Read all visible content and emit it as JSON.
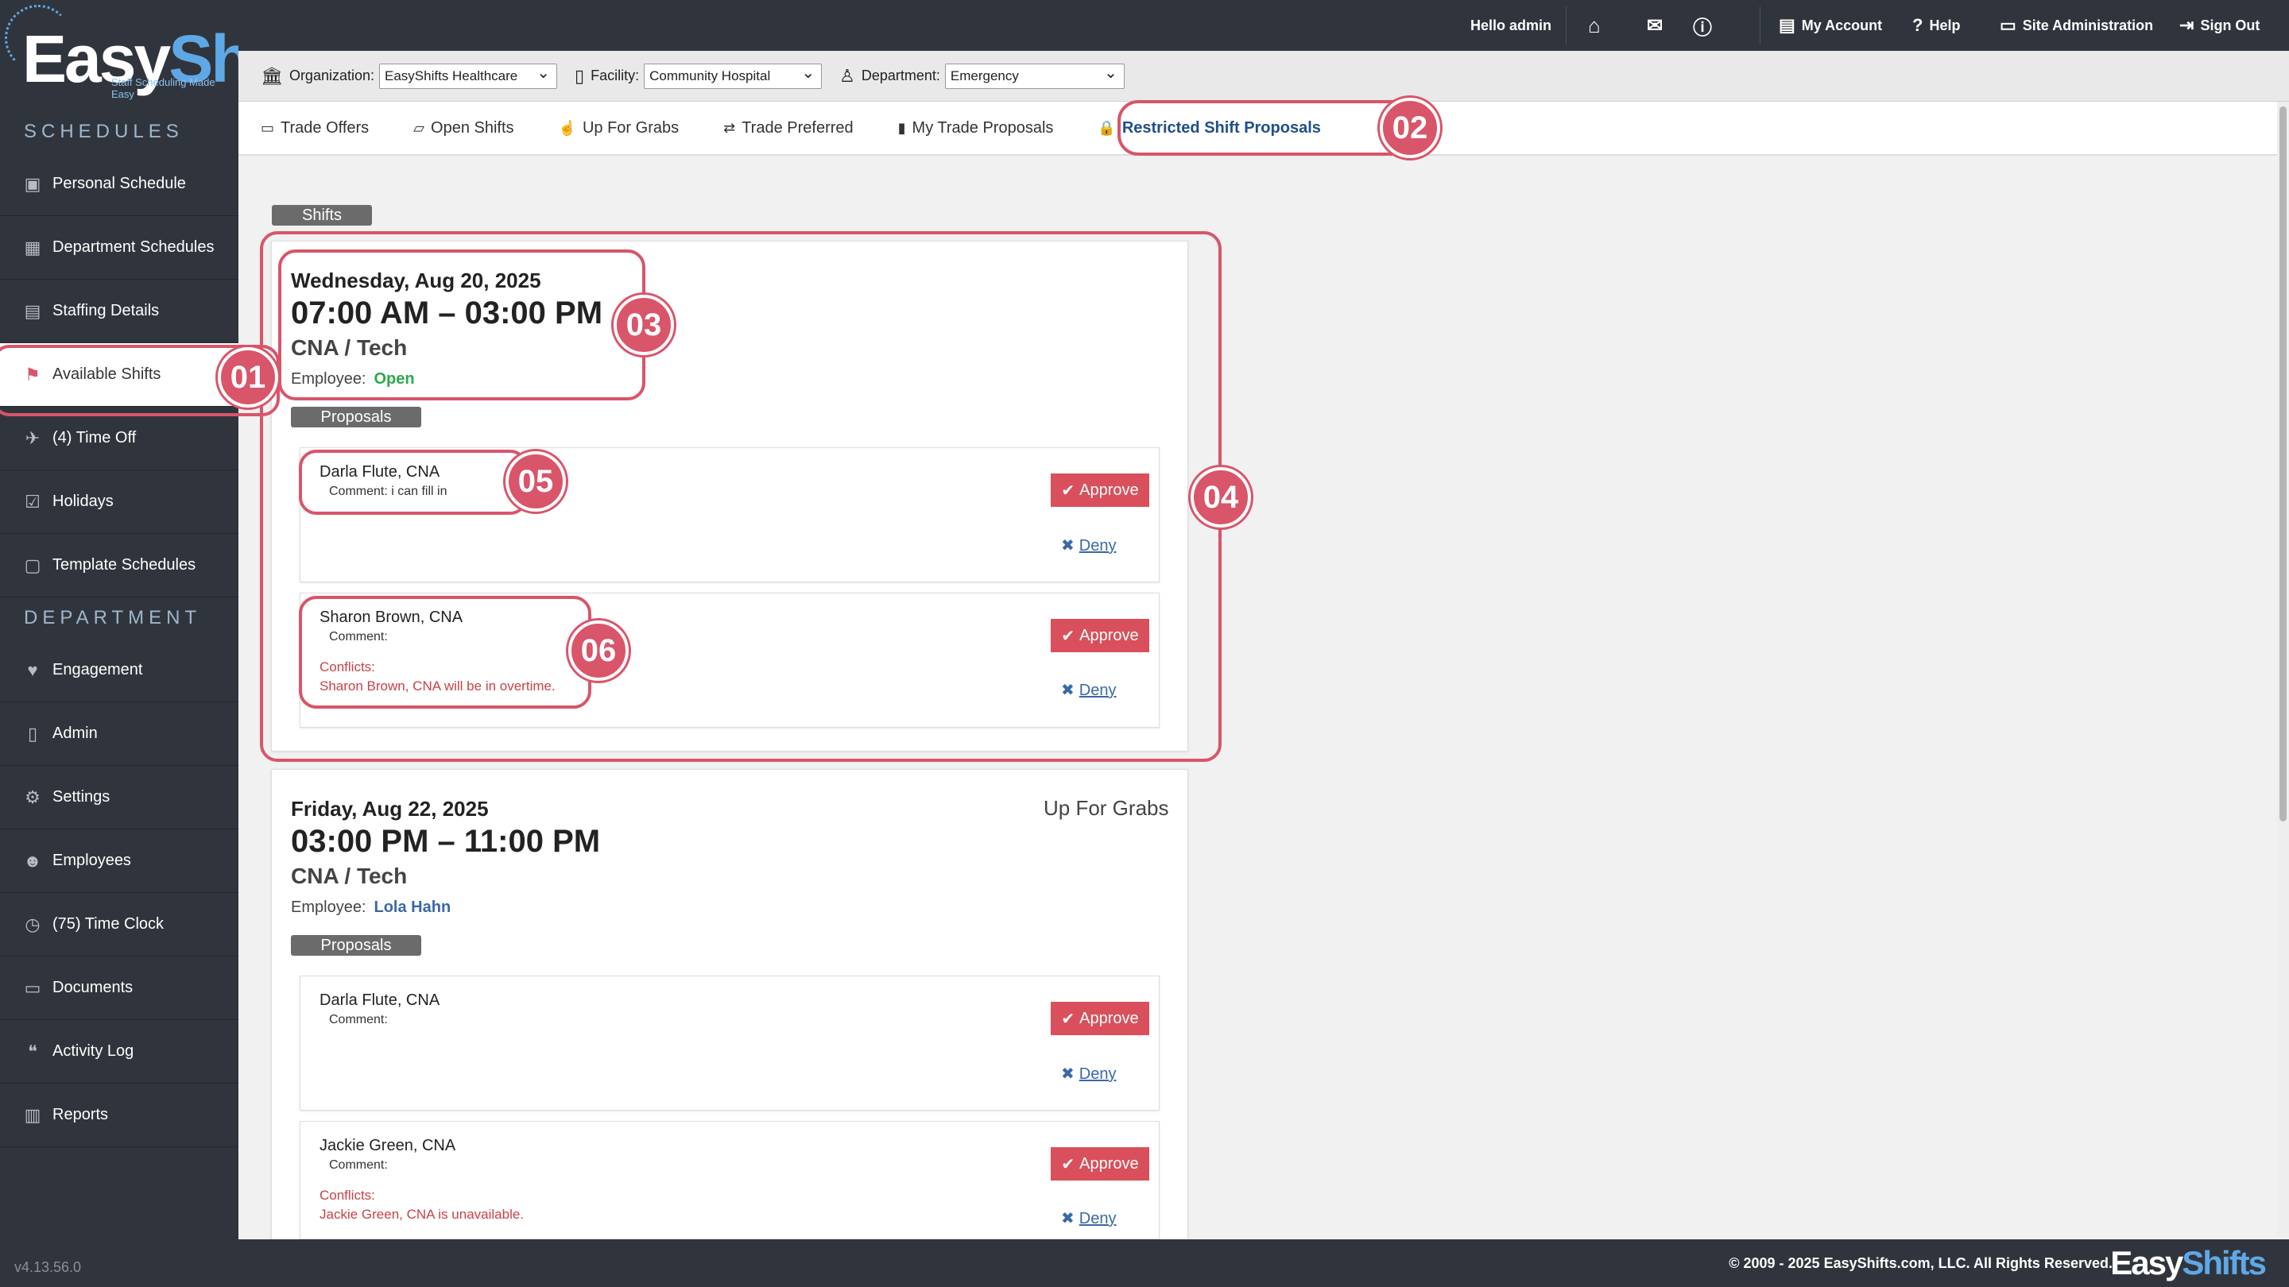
{
  "sidebar": {
    "logo": {
      "word1": "Easy",
      "word2": "Shifts",
      "tagline": "Staff Scheduling Made Easy"
    },
    "section_schedules": "SCHEDULES",
    "section_department": "DEPARTMENT",
    "schedule_items": [
      {
        "label": "Personal Schedule",
        "icon": "calendar-x-icon"
      },
      {
        "label": "Department Schedules",
        "icon": "calendar-grid-icon"
      },
      {
        "label": "Staffing Details",
        "icon": "table-icon"
      },
      {
        "label": "Available Shifts",
        "icon": "flag-icon"
      },
      {
        "label": "(4) Time Off",
        "icon": "plane-icon"
      },
      {
        "label": "Holidays",
        "icon": "calendar-check-icon"
      },
      {
        "label": "Template Schedules",
        "icon": "calendar-icon"
      }
    ],
    "department_items": [
      {
        "label": "Engagement",
        "icon": "heartbeat-icon"
      },
      {
        "label": "Admin",
        "icon": "clipboard-icon"
      },
      {
        "label": "Settings",
        "icon": "gear-icon"
      },
      {
        "label": "Employees",
        "icon": "users-icon"
      },
      {
        "label": "(75) Time Clock",
        "icon": "clock-icon"
      },
      {
        "label": "Documents",
        "icon": "document-icon"
      },
      {
        "label": "Activity Log",
        "icon": "chat-icon"
      },
      {
        "label": "Reports",
        "icon": "bar-chart-icon"
      }
    ],
    "version": "v4.13.56.0"
  },
  "topbar": {
    "greeting": "Hello admin",
    "my_account": "My Account",
    "help": "Help",
    "site_admin": "Site Administration",
    "sign_out": "Sign Out"
  },
  "filters": {
    "org_label": "Organization:",
    "org_value": "EasyShifts Healthcare",
    "facility_label": "Facility:",
    "facility_value": "Community Hospital",
    "dept_label": "Department:",
    "dept_value": "Emergency"
  },
  "tabs": [
    "Trade Offers",
    "Open Shifts",
    "Up For Grabs",
    "Trade Preferred",
    "My Trade Proposals",
    "Restricted Shift Proposals"
  ],
  "shifts_label": "Shifts",
  "proposals_label": "Proposals",
  "employee_label": "Employee:",
  "comment_label": "Comment:",
  "conflicts_label": "Conflicts:",
  "approve_label": "Approve",
  "deny_label": "Deny",
  "shift1": {
    "date": "Wednesday, Aug 20, 2025",
    "time": "07:00 AM – 03:00 PM",
    "role": "CNA / Tech",
    "employee": "Open",
    "proposals": [
      {
        "name": "Darla Flute, CNA",
        "comment": "Comment: i can fill in"
      },
      {
        "name": "Sharon Brown, CNA",
        "comment": "Comment:",
        "conflict": "Sharon Brown, CNA will be in overtime."
      }
    ]
  },
  "shift2": {
    "date": "Friday, Aug 22, 2025",
    "time": "03:00 PM – 11:00 PM",
    "role": "CNA / Tech",
    "employee": "Lola Hahn",
    "status": "Up For Grabs",
    "proposals": [
      {
        "name": "Darla Flute, CNA",
        "comment": "Comment:"
      },
      {
        "name": "Jackie Green, CNA",
        "comment": "Comment:",
        "conflict": "Jackie Green, CNA is unavailable."
      }
    ]
  },
  "callouts": [
    "01",
    "02",
    "03",
    "04",
    "05",
    "06"
  ],
  "footer": {
    "copyright": "© 2009 - 2025 EasyShifts.com, LLC. All Rights Reserved.",
    "logo1": "Easy",
    "logo2": "Shifts"
  },
  "colors": {
    "accent": "#d9556a",
    "sidebar": "#30353d",
    "open": "#2ea84a",
    "link": "#3a68a8"
  }
}
